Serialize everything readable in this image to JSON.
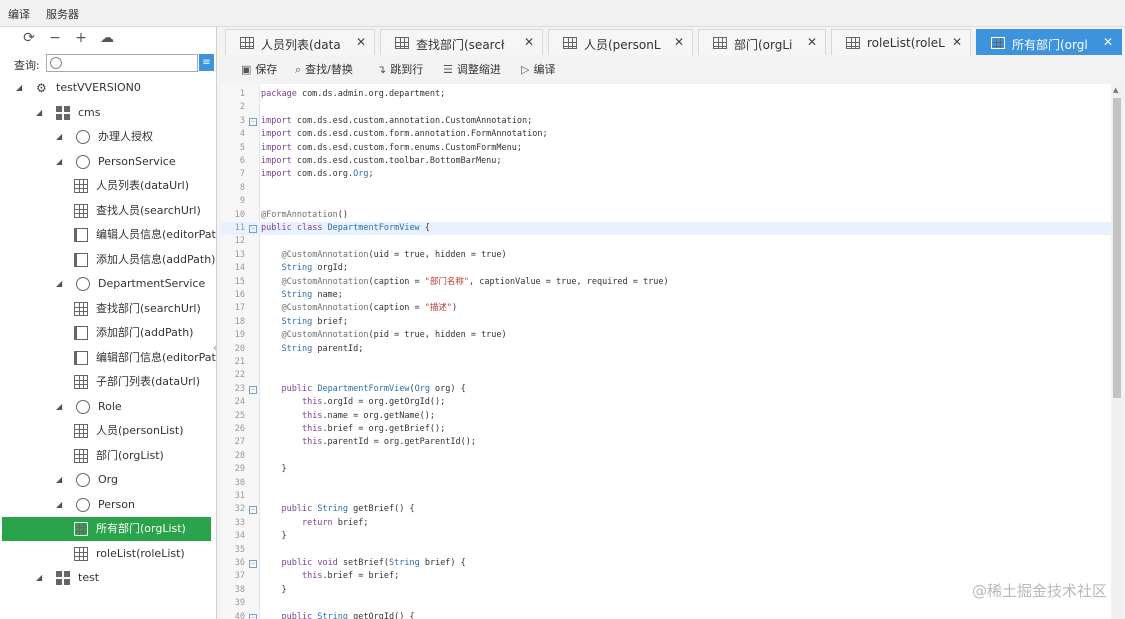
{
  "menubar": {
    "items": [
      "编译",
      "服务器"
    ]
  },
  "sidebar": {
    "search_label": "查询:",
    "toolbar_icons": [
      "refresh-icon",
      "minus-icon",
      "plus-icon",
      "cloud-upload-icon"
    ],
    "tree": [
      {
        "label": "testVVERSION0",
        "icon": "project",
        "level": 0,
        "expanded": true
      },
      {
        "label": "cms",
        "icon": "module",
        "level": 1,
        "expanded": true
      },
      {
        "label": "办理人授权",
        "icon": "service",
        "level": 2,
        "expanded": true
      },
      {
        "label": "PersonService",
        "icon": "service",
        "level": 2,
        "expanded": true
      },
      {
        "label": "人员列表(dataUrl)",
        "icon": "table",
        "level": 3
      },
      {
        "label": "查找人员(searchUrl)",
        "icon": "table",
        "level": 3
      },
      {
        "label": "编辑人员信息(editorPat",
        "icon": "form",
        "level": 3
      },
      {
        "label": "添加人员信息(addPath)",
        "icon": "form",
        "level": 3
      },
      {
        "label": "DepartmentService",
        "icon": "service",
        "level": 2,
        "expanded": true
      },
      {
        "label": "查找部门(searchUrl)",
        "icon": "table",
        "level": 3
      },
      {
        "label": "添加部门(addPath)",
        "icon": "form",
        "level": 3
      },
      {
        "label": "编辑部门信息(editorPat",
        "icon": "form",
        "level": 3
      },
      {
        "label": "子部门列表(dataUrl)",
        "icon": "table",
        "level": 3
      },
      {
        "label": "Role",
        "icon": "service",
        "level": 2,
        "expanded": true
      },
      {
        "label": "人员(personList)",
        "icon": "table",
        "level": 3
      },
      {
        "label": "部门(orgList)",
        "icon": "table",
        "level": 3
      },
      {
        "label": "Org",
        "icon": "service",
        "level": 2,
        "expanded": true
      },
      {
        "label": "Person",
        "icon": "service",
        "level": 2,
        "expanded": true
      },
      {
        "label": "所有部门(orgList)",
        "icon": "table",
        "level": 3,
        "selected": true
      },
      {
        "label": "roleList(roleList)",
        "icon": "table",
        "level": 3
      },
      {
        "label": "test",
        "icon": "module",
        "level": 1,
        "expanded": true
      }
    ]
  },
  "tabs": [
    {
      "label": "人员列表(data",
      "active": false
    },
    {
      "label": "查找部门(searcł",
      "active": false
    },
    {
      "label": "人员(personL",
      "active": false
    },
    {
      "label": "部门(orgLi",
      "active": false
    },
    {
      "label": "roleList(roleL",
      "active": false
    },
    {
      "label": "所有部门(orgl",
      "active": true
    }
  ],
  "editor_toolbar": {
    "save": "保存",
    "find_replace": "查找/替换",
    "goto_line": "跳到行",
    "indent": "调整缩进",
    "compile": "编译"
  },
  "code_lines": [
    {
      "n": "1",
      "t": "package com.ds.admin.org.department;"
    },
    {
      "n": "2",
      "t": ""
    },
    {
      "n": "3",
      "t": "import com.ds.esd.custom.annotation.CustomAnnotation;",
      "fold": true
    },
    {
      "n": "4",
      "t": "import com.ds.esd.custom.form.annotation.FormAnnotation;"
    },
    {
      "n": "5",
      "t": "import com.ds.esd.custom.form.enums.CustomFormMenu;"
    },
    {
      "n": "6",
      "t": "import com.ds.esd.custom.toolbar.BottomBarMenu;"
    },
    {
      "n": "7",
      "t": "import com.ds.org.Org;"
    },
    {
      "n": "8",
      "t": ""
    },
    {
      "n": "9",
      "t": ""
    },
    {
      "n": "10",
      "t": "@FormAnnotation()"
    },
    {
      "n": "11",
      "t": "public class DepartmentFormView {",
      "fold": true,
      "current": true
    },
    {
      "n": "12",
      "t": ""
    },
    {
      "n": "13",
      "t": "    @CustomAnnotation(uid = true, hidden = true)"
    },
    {
      "n": "14",
      "t": "    String orgId;"
    },
    {
      "n": "15",
      "t": "    @CustomAnnotation(caption = \"部门名称\", captionValue = true, required = true)"
    },
    {
      "n": "16",
      "t": "    String name;"
    },
    {
      "n": "17",
      "t": "    @CustomAnnotation(caption = \"描述\")"
    },
    {
      "n": "18",
      "t": "    String brief;"
    },
    {
      "n": "19",
      "t": "    @CustomAnnotation(pid = true, hidden = true)"
    },
    {
      "n": "20",
      "t": "    String parentId;"
    },
    {
      "n": "21",
      "t": ""
    },
    {
      "n": "22",
      "t": ""
    },
    {
      "n": "23",
      "t": "    public DepartmentFormView(Org org) {",
      "fold": true
    },
    {
      "n": "24",
      "t": "        this.orgId = org.getOrgId();"
    },
    {
      "n": "25",
      "t": "        this.name = org.getName();"
    },
    {
      "n": "26",
      "t": "        this.brief = org.getBrief();"
    },
    {
      "n": "27",
      "t": "        this.parentId = org.getParentId();"
    },
    {
      "n": "28",
      "t": ""
    },
    {
      "n": "29",
      "t": "    }"
    },
    {
      "n": "30",
      "t": ""
    },
    {
      "n": "31",
      "t": ""
    },
    {
      "n": "32",
      "t": "    public String getBrief() {",
      "fold": true
    },
    {
      "n": "33",
      "t": "        return brief;"
    },
    {
      "n": "34",
      "t": "    }"
    },
    {
      "n": "35",
      "t": ""
    },
    {
      "n": "36",
      "t": "    public void setBrief(String brief) {",
      "fold": true
    },
    {
      "n": "37",
      "t": "        this.brief = brief;"
    },
    {
      "n": "38",
      "t": "    }"
    },
    {
      "n": "39",
      "t": ""
    },
    {
      "n": "40",
      "t": "    public String getOrgId() {",
      "fold": true
    }
  ],
  "watermark": "@稀土掘金技术社区"
}
